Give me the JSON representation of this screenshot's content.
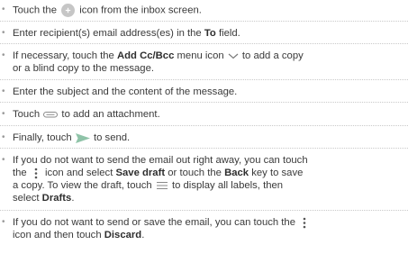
{
  "items": [
    {
      "p1": "Touch the ",
      "p2": " icon from the inbox screen."
    },
    {
      "p1": "Enter recipient(s) email address(es) in the ",
      "b1": "To",
      "p2": " field."
    },
    {
      "l1a": "If necessary, touch the ",
      "l1b": "Add Cc/Bcc",
      "l1c": " menu icon ",
      "l1d": " to add a copy",
      "l2": "or a blind copy to the message."
    },
    {
      "p1": "Enter the subject and the content of the message."
    },
    {
      "p1": "Touch ",
      "p2": " to add an attachment."
    },
    {
      "p1": "Finally, touch ",
      "p2": " to send."
    },
    {
      "l1": "If you do not want to send the email out right away, you can touch",
      "l2a": "the ",
      "l2b": " icon and select ",
      "l2c": "Save draft",
      "l2d": " or touch the ",
      "l2e": "Back",
      "l2f": " key to save",
      "l3a": "a copy. To view the draft, touch ",
      "l3b": " to display all labels, then",
      "l4a": "select ",
      "l4b": "Drafts",
      "l4c": "."
    },
    {
      "l1a": "If you do not want to send or save the email, you can touch the ",
      "l2a": "icon and then touch ",
      "l2b": "Discard",
      "l2c": "."
    }
  ],
  "icons": {
    "compose": "plus-circle-icon",
    "add_cc_bcc": "chevron-down-icon",
    "attachment": "paperclip-icon",
    "send": "send-arrow-icon",
    "more": "more-vertical-icon",
    "drawer": "hamburger-menu-icon"
  },
  "colors": {
    "text": "#3a3a3a",
    "icon_gray": "#bdbdbd",
    "send_green": "#8fc3a8"
  }
}
